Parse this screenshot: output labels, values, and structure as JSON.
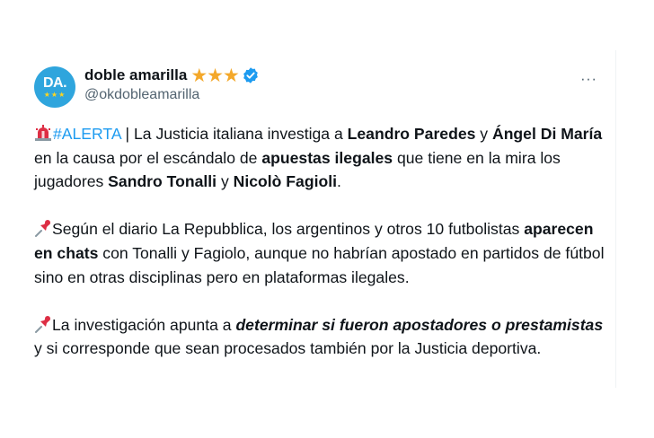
{
  "tweet": {
    "avatar": {
      "text": "DA.",
      "stars": "★★★"
    },
    "display_name": "doble amarilla",
    "name_stars": "★★★",
    "handle": "@okdobleamarilla",
    "more": "···",
    "p1": {
      "hashtag": "#ALERTA",
      "t1": " | La Justicia italiana investiga a ",
      "b1": "Leandro Paredes",
      "t2": " y ",
      "b2": "Ángel Di María",
      "t3": " en la causa por el escándalo de ",
      "b3": "apuestas ilegales",
      "t4": " que tiene en la mira los jugadores ",
      "b4": "Sandro Tonalli",
      "t5": " y ",
      "b5": "Nicolò Fagioli",
      "t6": "."
    },
    "p2": {
      "t1": "Según el diario La Repubblica, los argentinos y otros 10 futbolistas ",
      "b1": "aparecen en chats",
      "t2": " con Tonalli y Fagiolo, aunque no habrían apostado en partidos de fútbol sino en otras disciplinas pero en plataformas ilegales."
    },
    "p3": {
      "t1": "La investigación apunta a ",
      "b1": "determinar si fueron apostadores o prestamistas",
      "t2": " y si corresponde que sean procesados también por la Justicia deportiva."
    },
    "icons": {
      "siren": "rotating-light-emoji",
      "pin": "pushpin-emoji",
      "verified": "verified-badge-icon"
    },
    "colors": {
      "avatar_bg": "#2fa5dd",
      "link": "#1d9bf0",
      "stars": "#f4a82a",
      "handle": "#536471"
    }
  }
}
